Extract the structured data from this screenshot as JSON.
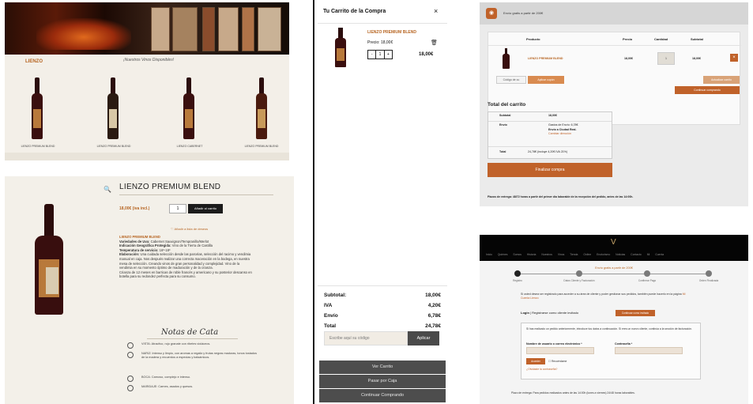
{
  "shop": {
    "logo": "LIENZO",
    "tagline": "¡Nuestros Vinos Disponibles!",
    "products": [
      "LIENZO PREMIUM BLEND",
      "LIENZO PREMIUM BLEND",
      "LIENZO CABERNET",
      "LIENZO PREMIUM BLEND"
    ]
  },
  "product": {
    "title": "LIENZO PREMIUM BLEND",
    "price": "18,00€ (iva incl.)",
    "qty": "1",
    "add_to_cart": "Añadir al carrito",
    "wishlist": "Añadir a lista de deseos",
    "category": "LIENZO PREMIUM BLEND",
    "varieties_label": "Variedades de Uva:",
    "varieties": "Cabernet Sauvignon/Tempranillo/Merlot",
    "origin_label": "Indicación Geográfica Protegida:",
    "origin": "Vino de la Tierra de Castilla",
    "temp_label": "Temperatura de servicio:",
    "temp": "16º-18º",
    "elab_label": "Elaboración:",
    "elab": "Una cuidada selección desde las parcelas, selección del racimo y vendimia manual en caja. Nos después realizar una correcta maceración en la bodega, en nuestra mesa de selección. Creando vinos de gran personalidad y complejidad. Vino de la vendimia en su momento óptimo de maduración y de la crianza.",
    "crianza": "Crianza de 12 meses en barricas de roble francés y americano y su posterior descanso en botella para su redondez perfecta para su consumo.",
    "notes_title": "Notas de Cata",
    "notes": [
      "VISTA: Atractivo, rojo granate con ribetes violáceos.",
      "NARIZ: Intenso y limpio, con aromas a regaliz y frutas negras maduras, tonos tostados de la madera y recuerdos a especias y balsámicos.",
      "BOCA: Carnoso, complejo e intenso.",
      "MARIDAJE: Carnes, asados y quesos."
    ]
  },
  "drawer": {
    "title": "Tu Carrito de la Compra",
    "close": "×",
    "item_name": "LIENZO PREMIUM BLEND",
    "item_price": "Precio: 18,00€",
    "trash": "🗑",
    "stepper_minus": "-",
    "stepper_qty": "1",
    "stepper_plus": "+",
    "item_total": "18,00€",
    "subtotal_label": "Subtotal:",
    "subtotal": "18,00€",
    "iva_label": "IVA",
    "iva": "4,20€",
    "envio_label": "Envío",
    "envio": "6,78€",
    "total_label": "Total",
    "total": "24,78€",
    "coupon_placeholder": "Escribe aquí su código",
    "apply": "Aplicar",
    "view_cart": "Ver Carrito",
    "checkout": "Pasar por Caja",
    "continue": "Continuar Comprando"
  },
  "cart": {
    "notice": "Envío gratis a partir de 200€",
    "headers": [
      "Producto",
      "Precio",
      "Cantidad",
      "Subtotal"
    ],
    "row_name": "LIENZO PREMIUM BLEND",
    "row_price": "18,00€",
    "row_qty": "1",
    "row_sub": "18,00€",
    "remove": "×",
    "coupon_code": "Código de cu",
    "apply_coupon": "Aplicar cupón",
    "update_cart": "Actualizar carrito",
    "continue_shopping": "Continuar comprando",
    "totals_title": "Total del carrito",
    "subtotal_label": "Subtotal",
    "subtotal": "18,00€",
    "envio_label": "Envío",
    "envio_lines": [
      "Gastos de Envío: 6,78€",
      "Envío a Ciudad Real.",
      "Cambiar dirección"
    ],
    "total_label": "Total",
    "total": "24,78€ (incluye 4,20€ IVA 21%)",
    "checkout": "Finalizar compra",
    "delivery_note": "Plazos de entrega: 48/72 horas a partir del primer día laborable de la recepción del pedido, antes de las 14:00h."
  },
  "checkout": {
    "logo": "V",
    "menu": "Inicio Quiénes Somos Historia Nuestros Vinos Tienda Online Enoturismo Noticias Contacto Mi Cuenta",
    "freeship": "Envío gratis a partir de 200€",
    "steps": [
      "Registro",
      "Datos Cliente y Facturación",
      "Confirmar Pago",
      "Orden Finalizada"
    ],
    "info": "Si usted desea ser registrado para acceder a su área de cliente y poder gestionar sus pedidos, también puede hacerlo en la página",
    "info_link": "Mi Cuenta Lienzo",
    "login_b": "Login",
    "login_rest": "| Registrarse como cliente invitado",
    "login_btn": "Continuar como invitado",
    "form_text": "Si has realizado un pedido anteriormente, introduce tus datos a continuación. Si eres un nuevo cliente, continúa a la sección de facturación.",
    "user_label": "Nombre de usuario o correo electrónico *",
    "pass_label": "Contraseña *",
    "access": "Acceder",
    "remember": "Recuérdame",
    "lost": "¿Olvidaste la contraseña?",
    "foot": "Plazo de entrega: Para pedidos realizados antes de las 14:00h (lunes a viernes) 24/48 horas laborables."
  }
}
